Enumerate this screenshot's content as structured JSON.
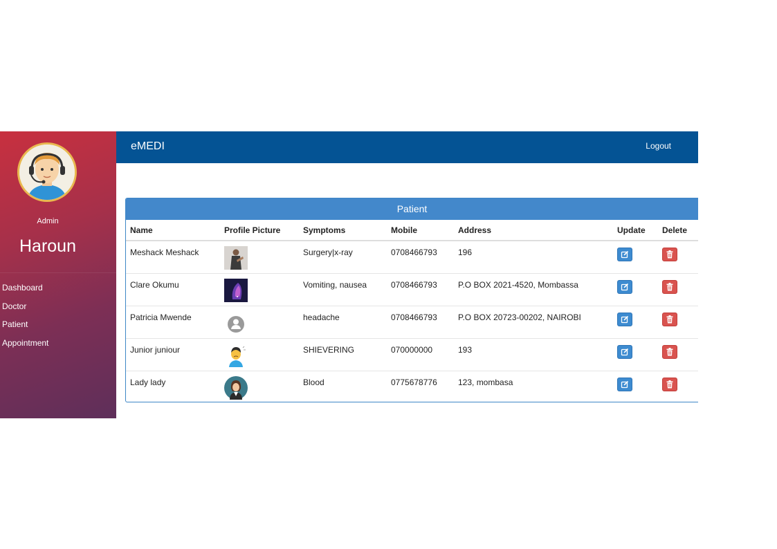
{
  "app": {
    "brand": "eMEDI",
    "logout_label": "Logout"
  },
  "sidebar": {
    "role": "Admin",
    "username": "Haroun",
    "items": [
      {
        "label": "Dashboard"
      },
      {
        "label": "Doctor"
      },
      {
        "label": "Patient"
      },
      {
        "label": "Appointment"
      }
    ]
  },
  "panel": {
    "title": "Patient"
  },
  "table": {
    "columns": [
      "Name",
      "Profile Picture",
      "Symptoms",
      "Mobile",
      "Address",
      "Update",
      "Delete"
    ],
    "rows": [
      {
        "name": "Meshack Meshack",
        "symptoms": "Surgery|x-ray",
        "mobile": "0708466793",
        "address": "196"
      },
      {
        "name": "Clare Okumu",
        "symptoms": "Vomiting, nausea",
        "mobile": "0708466793",
        "address": "P.O BOX 2021-4520, Mombassa"
      },
      {
        "name": "Patricia Mwende",
        "symptoms": "headache",
        "mobile": "0708466793",
        "address": "P.O BOX 20723-00202, NAIROBI"
      },
      {
        "name": "Junior juniour",
        "symptoms": "SHIEVERING",
        "mobile": "070000000",
        "address": "193"
      },
      {
        "name": "Lady lady",
        "symptoms": "Blood",
        "mobile": "0775678776",
        "address": "123, mombasa"
      }
    ]
  },
  "colors": {
    "topbar": "#045394",
    "panel_header": "#4388cb",
    "edit_button": "#3d8bd0",
    "delete_button": "#d9534f"
  }
}
